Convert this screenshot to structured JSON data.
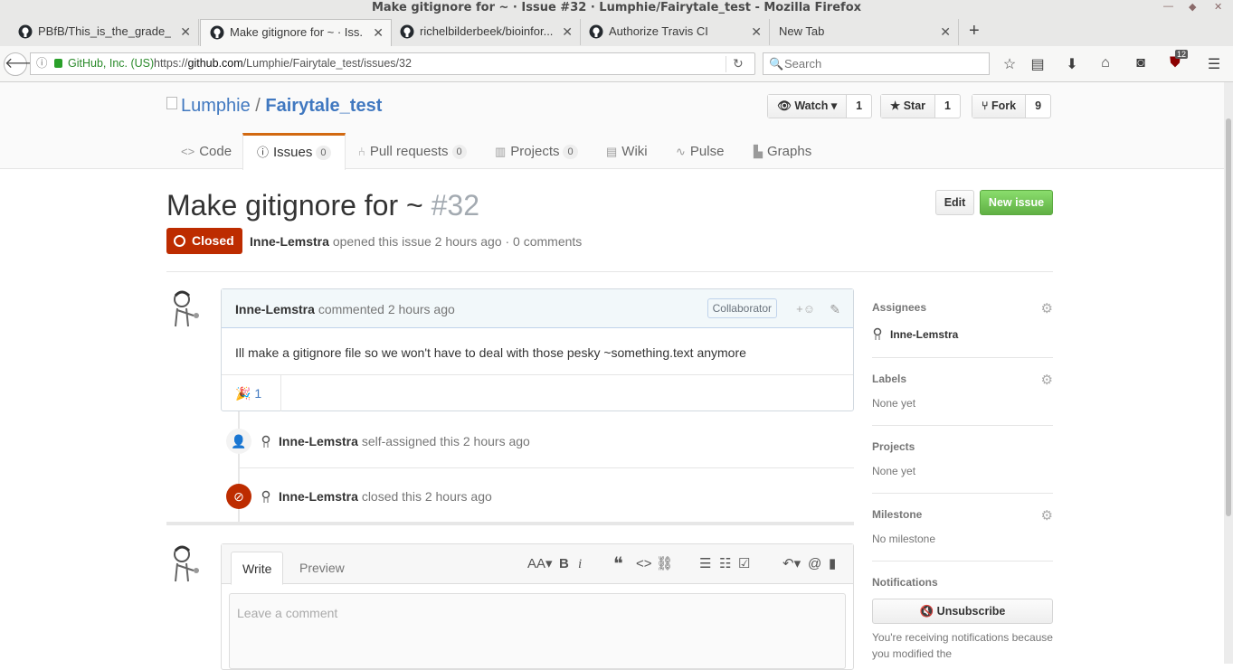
{
  "window": {
    "title": "Make gitignore for ~ · Issue #32 · Lumphie/Fairytale_test - Mozilla Firefox"
  },
  "tabs": [
    {
      "label": "PBfB/This_is_the_grade_I...",
      "close": "✕"
    },
    {
      "label": "Make gitignore for ~ · Iss...",
      "close": "✕"
    },
    {
      "label": "richelbilderbeek/bioinfor...",
      "close": "✕"
    },
    {
      "label": "Authorize Travis CI",
      "close": "✕"
    },
    {
      "label": "New Tab",
      "close": "✕"
    }
  ],
  "newtab": "+",
  "navbar": {
    "org": "GitHub, Inc. (US)",
    "url_prefix": "https://",
    "url_host": "github.com",
    "url_path": "/Lumphie/Fairytale_test/issues/32",
    "search_placeholder": "Search",
    "badge": "12"
  },
  "repo": {
    "owner": "Lumphie",
    "sep": "/",
    "name": "Fairytale_test",
    "watch_label": "Watch",
    "watch_count": "1",
    "star_label": "Star",
    "star_count": "1",
    "fork_label": "Fork",
    "fork_count": "9"
  },
  "repo_tabs": [
    {
      "label": "Code"
    },
    {
      "label": "Issues",
      "count": "0"
    },
    {
      "label": "Pull requests",
      "count": "0"
    },
    {
      "label": "Projects",
      "count": "0"
    },
    {
      "label": "Wiki"
    },
    {
      "label": "Pulse"
    },
    {
      "label": "Graphs"
    }
  ],
  "issue": {
    "title": "Make gitignore for ~",
    "number": "#32",
    "edit_label": "Edit",
    "new_label": "New issue",
    "state": "Closed",
    "author": "Inne-Lemstra",
    "meta": "opened this issue 2 hours ago · 0 comments"
  },
  "comment": {
    "author": "Inne-Lemstra",
    "when": "commented 2 hours ago",
    "role": "Collaborator",
    "body": "Ill make a gitignore file so we won't have to deal with those pesky ~something.text anymore",
    "reaction_emoji": "🎉",
    "reaction_count": "1"
  },
  "events": [
    {
      "author": "Inne-Lemstra",
      "text": "self-assigned this 2 hours ago"
    },
    {
      "author": "Inne-Lemstra",
      "text": "closed this 2 hours ago"
    }
  ],
  "editor": {
    "write_tab": "Write",
    "preview_tab": "Preview",
    "placeholder": "Leave a comment"
  },
  "sidebar": {
    "assignees_label": "Assignees",
    "assignee": "Inne-Lemstra",
    "labels_label": "Labels",
    "labels_value": "None yet",
    "projects_label": "Projects",
    "projects_value": "None yet",
    "milestone_label": "Milestone",
    "milestone_value": "No milestone",
    "notifications_label": "Notifications",
    "unsubscribe_label": "Unsubscribe",
    "notification_note": "You're receiving notifications because you modified the"
  },
  "colors": {
    "closed": "#bd2c00",
    "new_issue": "#6cc644",
    "link": "#4078c0",
    "active_tab": "#d26911"
  }
}
